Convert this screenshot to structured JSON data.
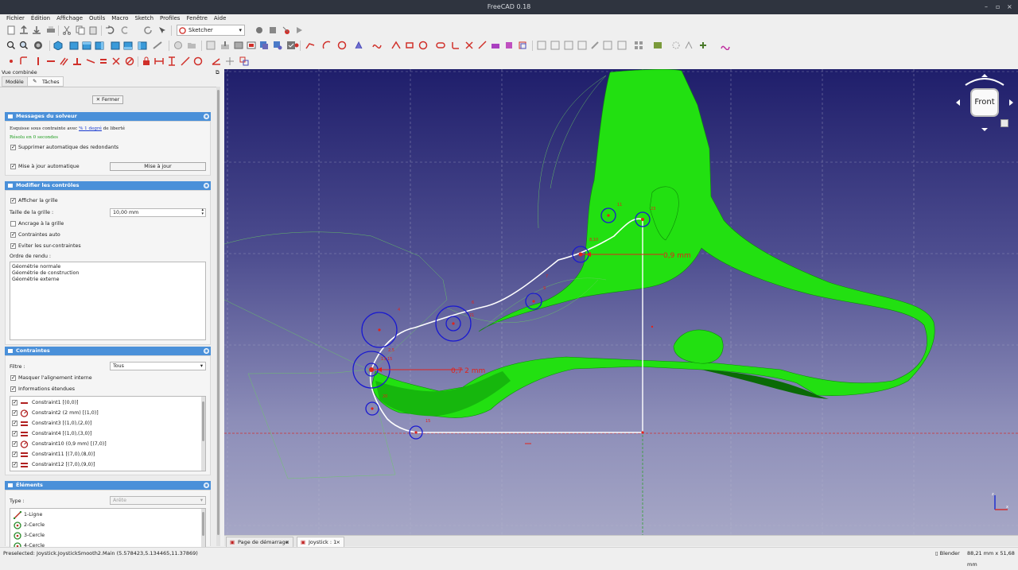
{
  "window": {
    "title": "FreeCAD 0.18",
    "controls": [
      "–",
      "▫",
      "×"
    ]
  },
  "menu": [
    "Fichier",
    "Édition",
    "Affichage",
    "Outils",
    "Macro",
    "Sketch",
    "Profiles",
    "Fenêtre",
    "Aide"
  ],
  "toolbar": {
    "workbench": "Sketcher"
  },
  "panel": {
    "title": "Vue combinée",
    "tabs": [
      "Modèle",
      "Tâches"
    ],
    "close_label": "Fermer",
    "solver": {
      "header": "Messages du solveur",
      "msg_prefix": "Esquisse sous contrainte avec",
      "msg_link": "% 1 degré",
      "msg_suffix": "de liberté",
      "solved": "Résolu en 0 secondes",
      "remove_redundant": "Supprimer automatique des redondants",
      "auto_update": "Mise à jour automatique",
      "update_button": "Mise à jour"
    },
    "edit": {
      "header": "Modifier les contrôles",
      "show_grid": "Afficher la grille",
      "grid_size_label": "Taille de la grille :",
      "grid_size_value": "10,00 mm",
      "grid_snap": "Ancrage à la grille",
      "auto_constraints": "Contraintes auto",
      "avoid_redundant": "Eviter les sur-contraintes",
      "render_order_label": "Ordre de rendu :",
      "render_order": [
        "Géométrie normale",
        "Géométrie de construction",
        "Géométrie externe"
      ]
    },
    "constraints": {
      "header": "Contraintes",
      "filter_label": "Filtre :",
      "filter_value": "Tous",
      "hide_internal": "Masquer l'alignement interne",
      "extended_info": "Informations étendues",
      "items": [
        {
          "label": "Constraint1 [(0,0)]",
          "icon": "horizontal-icon"
        },
        {
          "label": "Constraint2 (2 mm) [(1,0)]",
          "icon": "radius-icon"
        },
        {
          "label": "Constraint3 [(1,0),(2,0)]",
          "icon": "equal-icon"
        },
        {
          "label": "Constraint4 [(1,0),(3,0)]",
          "icon": "equal-icon"
        },
        {
          "label": "Constraint10 (0,9 mm) [(7,0)]",
          "icon": "radius-icon"
        },
        {
          "label": "Constraint11 [(7,0),(8,0)]",
          "icon": "equal-icon"
        },
        {
          "label": "Constraint12 [(7,0),(9,0)]",
          "icon": "equal-icon"
        }
      ]
    },
    "elements": {
      "header": "Éléments",
      "type_label": "Type :",
      "type_value": "Arête",
      "items": [
        "1-Ligne",
        "2-Cercle",
        "3-Cercle",
        "4-Cercle"
      ]
    }
  },
  "viewport": {
    "navcube_face": "Front",
    "dimension_1": "0,9 mm",
    "dimension_2": "0,7 2 mm",
    "labels": [
      "11",
      "23",
      "12",
      "8,10",
      "9",
      "6",
      "4",
      "2,5",
      "13,15",
      "20",
      "15",
      "7",
      "21",
      "11"
    ]
  },
  "doc_tabs": [
    "Page de démarrage",
    "Joystick : 1"
  ],
  "status": {
    "preselected": "Preselected: Joystick.JoystickSmooth2.Main (5.578423,5.134465,11.37869)",
    "nav_style": "Blender",
    "dimensions": "88,21 mm x 51,68 mm"
  },
  "colors": {
    "accent": "#4a90d9",
    "mesh": "#22e011",
    "constraint": "#e0231b",
    "curve": "#ffffff"
  }
}
